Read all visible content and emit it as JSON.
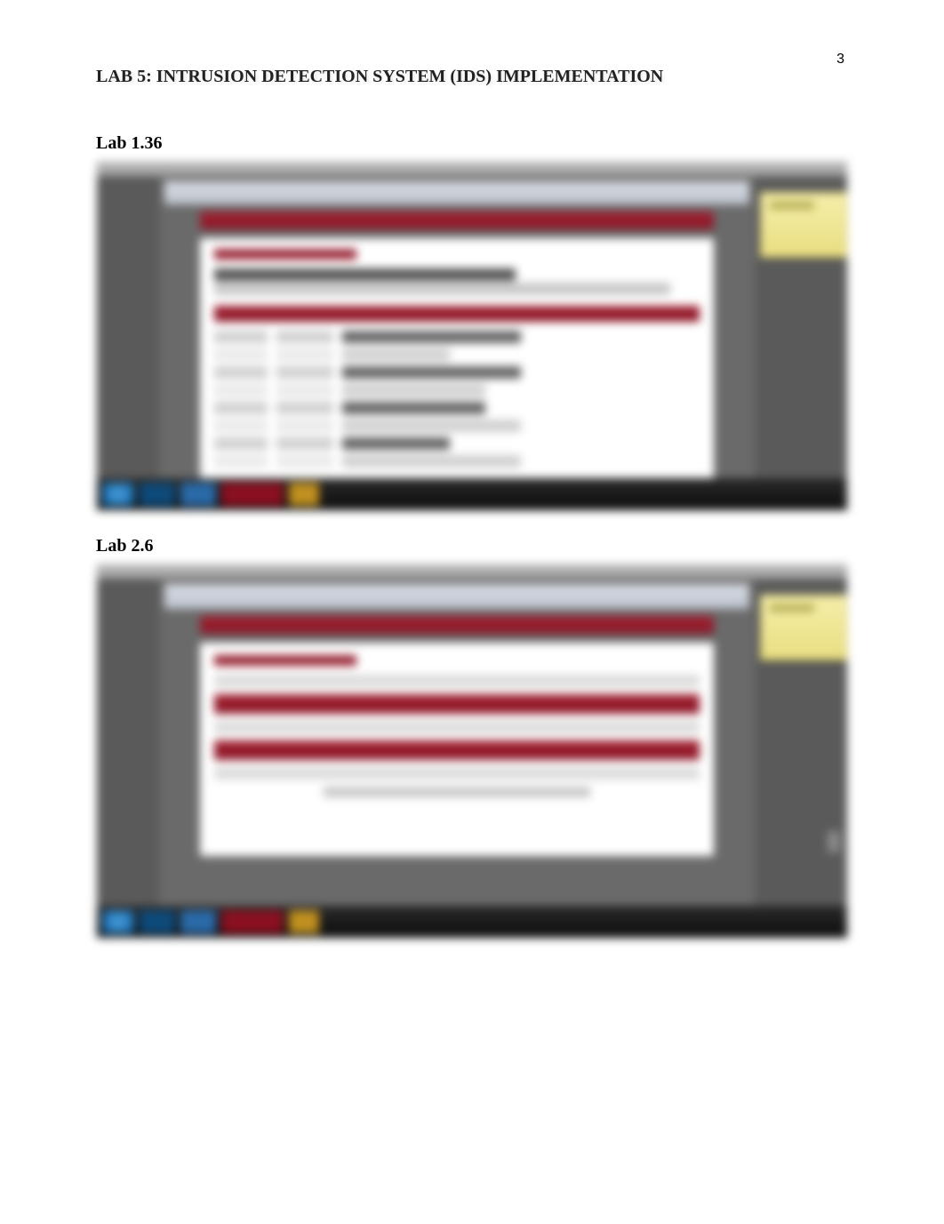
{
  "page_number": "3",
  "document_title": "LAB 5: INTRUSION DETECTION SYSTEM (IDS) IMPLEMENTATION",
  "sections": [
    {
      "label": "Lab 1.36"
    },
    {
      "label": "Lab 2.6"
    }
  ]
}
